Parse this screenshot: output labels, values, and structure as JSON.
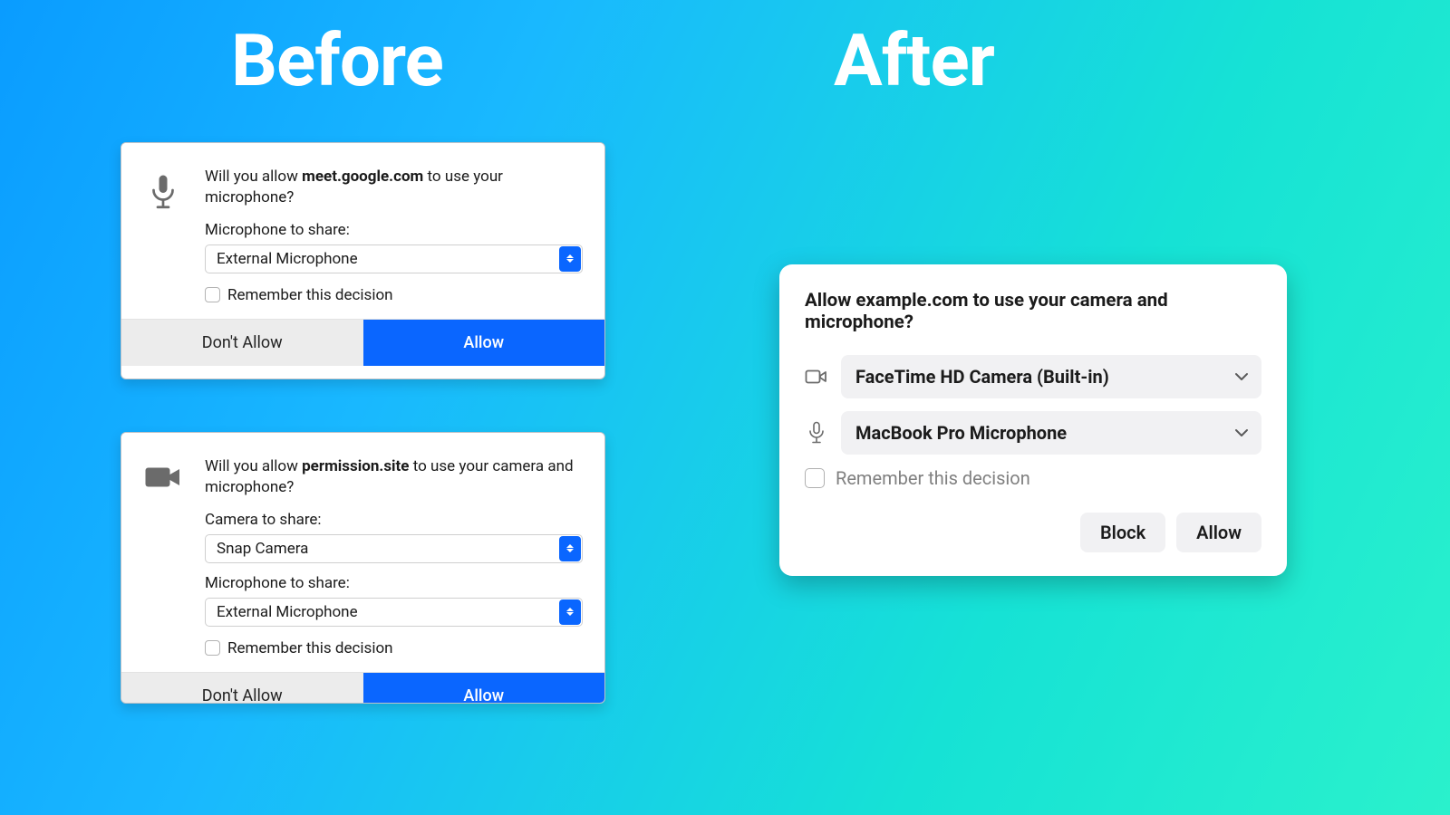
{
  "headings": {
    "before": "Before",
    "after": "After"
  },
  "before1": {
    "prompt_prefix": "Will you allow ",
    "prompt_site": "meet.google.com",
    "prompt_suffix": " to use your microphone?",
    "mic_label": "Microphone to share:",
    "mic_value": "External Microphone",
    "remember": "Remember this decision",
    "deny": "Don't Allow",
    "allow": "Allow"
  },
  "before2": {
    "prompt_prefix": "Will you allow ",
    "prompt_site": "permission.site",
    "prompt_suffix": " to use your camera and microphone?",
    "cam_label": "Camera to share:",
    "cam_value": "Snap Camera",
    "mic_label": "Microphone to share:",
    "mic_value": "External Microphone",
    "remember": "Remember this decision",
    "deny": "Don't Allow",
    "allow": "Allow"
  },
  "after": {
    "title": "Allow example.com to use your camera and microphone?",
    "camera_value": "FaceTime HD Camera (Built-in)",
    "mic_value": "MacBook Pro Microphone",
    "remember": "Remember this decision",
    "block": "Block",
    "allow": "Allow"
  }
}
